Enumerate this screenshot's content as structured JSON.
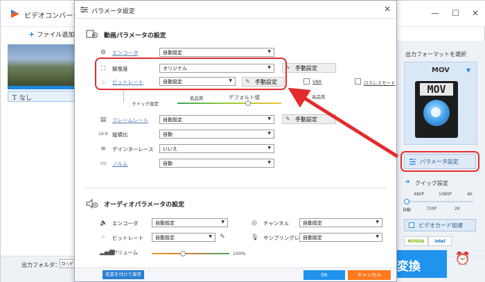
{
  "app": {
    "title": "ビデオコンバータ",
    "window_controls": [
      "—",
      "☐",
      "✕"
    ],
    "add_file": "ファイル追加",
    "subtitle_none": "なし",
    "output_folder_label": "出力フォルダ：",
    "output_folder_value": "D:\\デスク",
    "accent_color": "#1e88e5"
  },
  "format_panel": {
    "title": "出力フォーマットを選択",
    "format": "MOV",
    "icon_text": "MOV",
    "param_button": "パラメータ設定",
    "quick_title": "クイック設定",
    "quick_top": [
      "480P",
      "1080P",
      "4K"
    ],
    "quick_bottom": [
      "自動",
      "720P",
      "2K"
    ],
    "gpu_button": "ビデオカード加速",
    "gpu_vendors": [
      "NVIDIA",
      "intel"
    ],
    "convert_button": "変換"
  },
  "dialog": {
    "title": "パラメータ設定",
    "close": "✕",
    "video_section": "動画パラメータの設定",
    "audio_section": "オーディオパラメータの設定",
    "encoder": {
      "label": "エンコーダ",
      "value": "自動設定"
    },
    "resolution": {
      "label": "解像度",
      "value": "オリジナル",
      "button": "手動設定"
    },
    "bitrate": {
      "label": "ビットレート",
      "value": "自動設定",
      "button": "手動設定",
      "vbr": "VBR",
      "lossless": "ロスレスモード"
    },
    "quick": {
      "label": "クイック設定",
      "low": "低品質",
      "default": "デフォルト値",
      "high": "高品質"
    },
    "framerate": {
      "label": "フレームレート",
      "value": "自動設定",
      "button": "手動設定"
    },
    "aspect": {
      "label": "縦横比",
      "value": "自動"
    },
    "deinterlace": {
      "label": "デインターレース",
      "value": "いいえ"
    },
    "norm": {
      "label": "ノルム",
      "value": "自動"
    },
    "audio_encoder": {
      "label": "エンコーダ",
      "value": "自動設定"
    },
    "audio_bitrate": {
      "label": "ビットレート",
      "value": "自動設定"
    },
    "channel": {
      "label": "チャンネル",
      "value": "自動設定"
    },
    "sampling": {
      "label": "サンプリングレート",
      "value": "自動設定"
    },
    "volume": {
      "label": "ボリューム",
      "value": "100%",
      "level": 0.4
    },
    "save_name_button": "名前を付けて保存",
    "ok_button": "Ok",
    "cancel_button": "キャンセル",
    "highlight_color": "#e32b2b"
  }
}
